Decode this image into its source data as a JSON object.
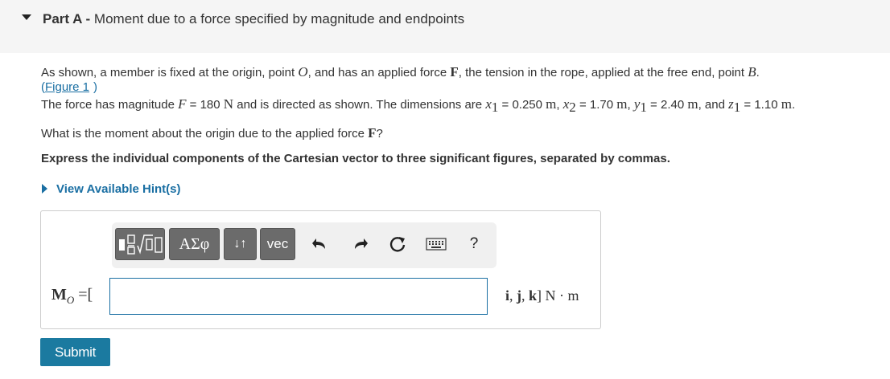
{
  "part": {
    "label": "Part A",
    "separator": " - ",
    "title": "Moment due to a force specified by magnitude and endpoints"
  },
  "problem": {
    "p1_a": "As shown, a member is fixed at the origin, point ",
    "p1_O": "O",
    "p1_b": ", and has an applied force ",
    "p1_F": "F",
    "p1_c": ", the tension in the rope, applied at the free end, point ",
    "p1_B": "B",
    "p1_d": ".",
    "figure_link": "Figure 1",
    "p2_a": "The force has magnitude ",
    "p2_F": "F",
    "p2_eq1": " = 180 ",
    "p2_N": "N",
    "p2_b": " and is directed as shown. The dimensions are ",
    "x1": "x",
    "x1_val": " = 0.250 ",
    "x2": "x",
    "x2_val": " = 1.70 ",
    "y1": "y",
    "y1_val": " = 2.40 ",
    "z1": "z",
    "z1_val": " = 1.10 ",
    "unit_m": "m",
    "sub1": "1",
    "sub2": "2",
    "comma": ", ",
    "and": ", and ",
    "question_a": "What is the moment about the origin due to the applied force ",
    "question_F": "F",
    "question_b": "?",
    "instruction": "Express the individual components of the Cartesian vector to three significant figures, separated by commas."
  },
  "hint": {
    "label": "View Available Hint(s)"
  },
  "toolbar": {
    "greek_label": "ΑΣφ",
    "arrows_label": "↓↑",
    "vec_label": "vec",
    "help_label": "?"
  },
  "answer": {
    "label_M": "M",
    "label_sub": "O",
    "label_eq": " =[",
    "value": "",
    "units": "i, j, k] N · m"
  },
  "submit_label": "Submit",
  "colors": {
    "link": "#1a6fa3",
    "submit_bg": "#1b7aa0",
    "toolbar_btn": "#6b6b6b"
  }
}
